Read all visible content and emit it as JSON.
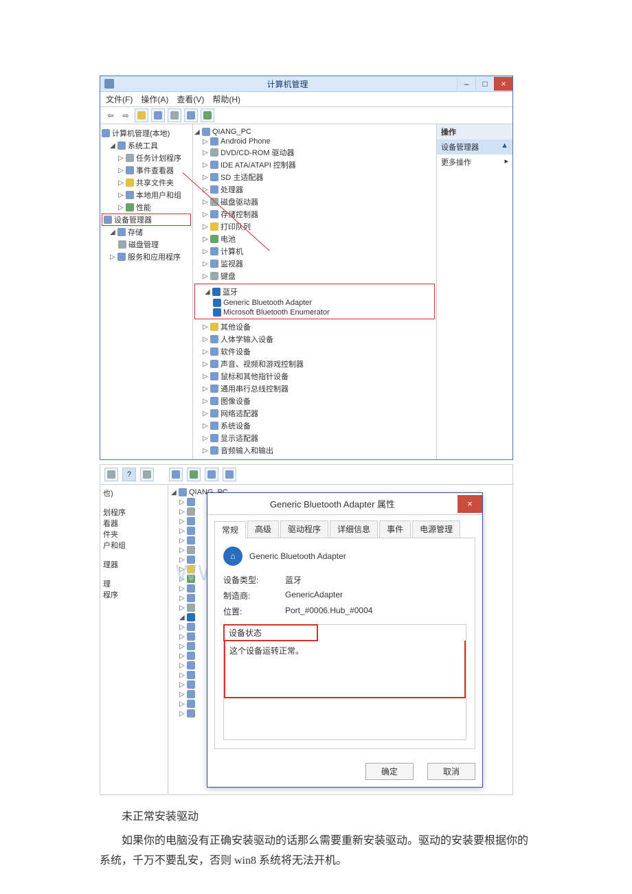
{
  "screenshot1": {
    "window_title": "计算机管理",
    "win_buttons": {
      "min": "–",
      "max": "□",
      "close": "×"
    },
    "menubar": [
      "文件(F)",
      "操作(A)",
      "查看(V)",
      "帮助(H)"
    ],
    "toolbar_arrows": {
      "back": "⇦",
      "fwd": "⇨"
    },
    "left_tree": {
      "root": "计算机管理(本地)",
      "sys_tools": "系统工具",
      "items": [
        "任务计划程序",
        "事件查看器",
        "共享文件夹",
        "本地用户和组",
        "性能"
      ],
      "dev_mgr": "设备管理器",
      "storage": "存储",
      "disk_mgmt": "磁盘管理",
      "services": "服务和应用程序"
    },
    "mid_tree": {
      "root": "QIANG_PC",
      "items_top": [
        "Android Phone",
        "DVD/CD-ROM 驱动器",
        "IDE ATA/ATAPI 控制器",
        "SD 主适配器",
        "处理器",
        "磁盘驱动器",
        "存储控制器",
        "打印队列",
        "电池",
        "计算机",
        "监视器",
        "键盘"
      ],
      "bt_root": "蓝牙",
      "bt_children": [
        "Generic Bluetooth Adapter",
        "Microsoft Bluetooth Enumerator"
      ],
      "items_bottom": [
        "其他设备",
        "人体学输入设备",
        "软件设备",
        "声音、视频和游戏控制器",
        "鼠标和其他指针设备",
        "通用串行总线控制器",
        "图像设备",
        "网络适配器",
        "系统设备",
        "显示适配器",
        "音频输入和输出"
      ]
    },
    "right_panel": {
      "header": "操作",
      "sub": "设备管理器",
      "more": "更多操作",
      "arrow": "▸"
    }
  },
  "screenshot2": {
    "left_frag": [
      "也)",
      "",
      "划程序",
      "看器",
      "件夹",
      "户和组",
      "",
      "理器",
      "",
      "理",
      "程序"
    ],
    "mid_root": "QIANG_PC",
    "dialog": {
      "title": "Generic Bluetooth Adapter 属性",
      "close": "×",
      "tabs": [
        "常规",
        "高级",
        "驱动程序",
        "详细信息",
        "事件",
        "电源管理"
      ],
      "device_name": "Generic Bluetooth Adapter",
      "rows": {
        "type_label": "设备类型:",
        "type_value": "蓝牙",
        "mfr_label": "制造商:",
        "mfr_value": "GenericAdapter",
        "loc_label": "位置:",
        "loc_value": "Port_#0006.Hub_#0004"
      },
      "status_header": "设备状态",
      "status_text": "这个设备运转正常。",
      "ok": "确定",
      "cancel": "取消"
    },
    "watermark": "www.bdocx.com"
  },
  "body_text": {
    "p1": "未正常安装驱动",
    "p2": "如果你的电脑没有正确安装驱动的话那么需要重新安装驱动。驱动的安装要根据你的系统，千万不要乱安，否则 win8 系统将无法开机。"
  }
}
